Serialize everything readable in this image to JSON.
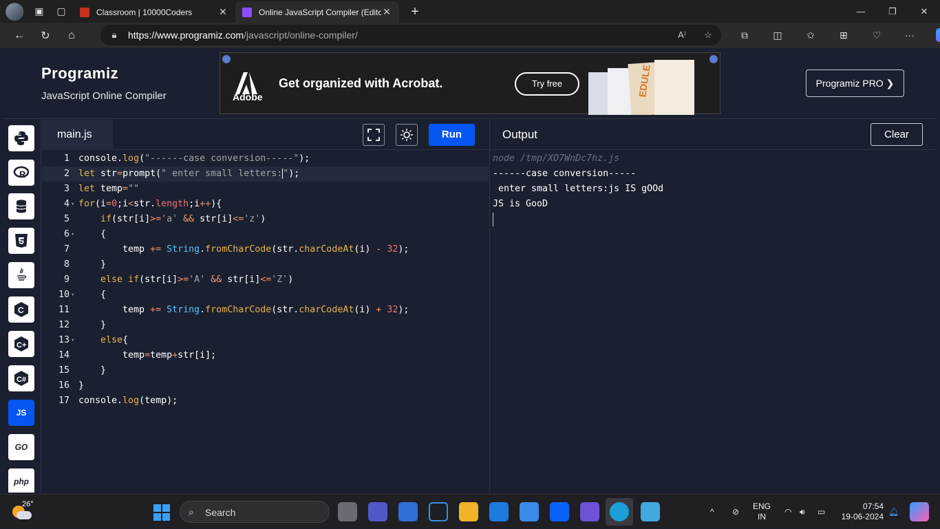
{
  "browser": {
    "tabs": [
      {
        "title": "Classroom | 10000Coders",
        "favicon_color": "#c9321f",
        "active": false
      },
      {
        "title": "Online JavaScript Compiler (Edito",
        "favicon_color": "#8a4dff",
        "active": true
      }
    ],
    "url_host": "https://www.programiz.com",
    "url_path": "/javascript/online-compiler/"
  },
  "header": {
    "logo": "Programiz",
    "subtitle": "JavaScript Online Compiler",
    "pro_button": "Programiz PRO ❯"
  },
  "ad": {
    "brand": "Adobe",
    "headline": "Get organized with Acrobat.",
    "cta": "Try free"
  },
  "sidebar": {
    "languages": [
      "python",
      "r",
      "sql",
      "html",
      "java",
      "c",
      "cpp",
      "csharp",
      "js",
      "go",
      "php"
    ],
    "active": "js",
    "labels": {
      "js": "JS",
      "go": "GO",
      "php": "php"
    }
  },
  "editor": {
    "filename": "main.js",
    "run_label": "Run",
    "line_numbers": [
      "1",
      "2",
      "3",
      "4",
      "5",
      "6",
      "7",
      "8",
      "9",
      "10",
      "11",
      "12",
      "13",
      "14",
      "15",
      "16",
      "17"
    ],
    "current_line": 2
  },
  "output": {
    "title": "Output",
    "clear_label": "Clear",
    "lines": [
      "node /tmp/XO7WnDc7hz.js",
      "------case conversion-----",
      " enter small letters:js IS gOOd",
      "JS is GooD"
    ]
  },
  "taskbar": {
    "temperature": "26°",
    "search_label": "Search",
    "language": "ENG",
    "region": "IN",
    "time": "07:54",
    "date": "19-06-2024"
  },
  "colors": {
    "accent": "#0556f3",
    "background": "#1b2030"
  }
}
